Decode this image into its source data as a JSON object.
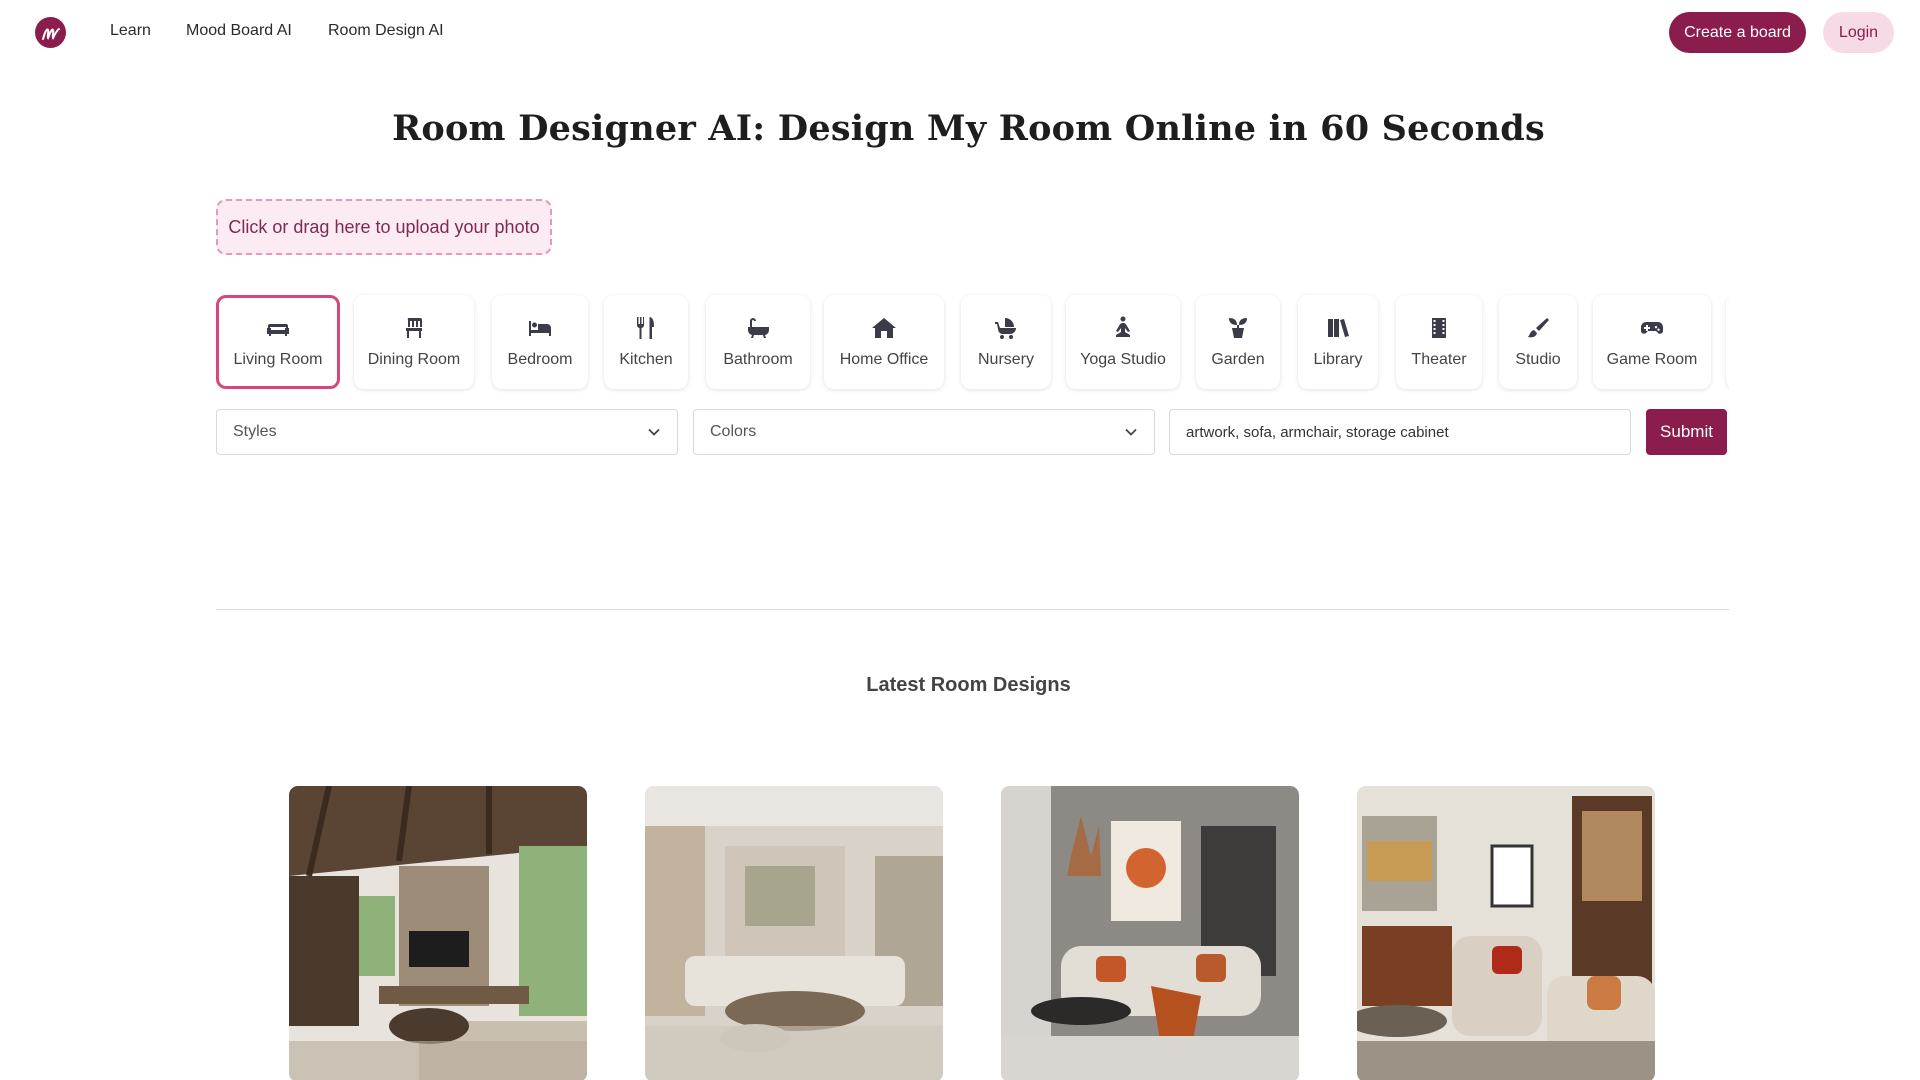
{
  "nav": {
    "logo_letter": "m",
    "links": [
      "Learn",
      "Mood Board AI",
      "Room Design AI"
    ],
    "create_label": "Create a board",
    "login_label": "Login"
  },
  "page_title": "Room Designer AI: Design My Room Online in 60 Seconds",
  "upload_label": "Click or drag here to upload your photo",
  "rooms": [
    {
      "label": "Living Room",
      "icon": "sofa-icon"
    },
    {
      "label": "Dining Room",
      "icon": "chair-icon"
    },
    {
      "label": "Bedroom",
      "icon": "bed-icon"
    },
    {
      "label": "Kitchen",
      "icon": "utensils-icon"
    },
    {
      "label": "Bathroom",
      "icon": "bathtub-icon"
    },
    {
      "label": "Home Office",
      "icon": "house-icon"
    },
    {
      "label": "Nursery",
      "icon": "stroller-icon"
    },
    {
      "label": "Yoga Studio",
      "icon": "meditation-icon"
    },
    {
      "label": "Garden",
      "icon": "plant-icon"
    },
    {
      "label": "Library",
      "icon": "books-icon"
    },
    {
      "label": "Theater",
      "icon": "film-icon"
    },
    {
      "label": "Studio",
      "icon": "paintbrush-icon"
    },
    {
      "label": "Game Room",
      "icon": "gamepad-icon"
    }
  ],
  "selected_room": "Living Room",
  "filters": {
    "styles_label": "Styles",
    "colors_label": "Colors",
    "items_value": "artwork, sofa, armchair, storage cabinet",
    "submit_label": "Submit"
  },
  "latest_title": "Latest Room Designs",
  "colors": {
    "brand": "#8b1d4c",
    "brand_light": "#f6dbe6",
    "active_border": "#d8467f"
  }
}
